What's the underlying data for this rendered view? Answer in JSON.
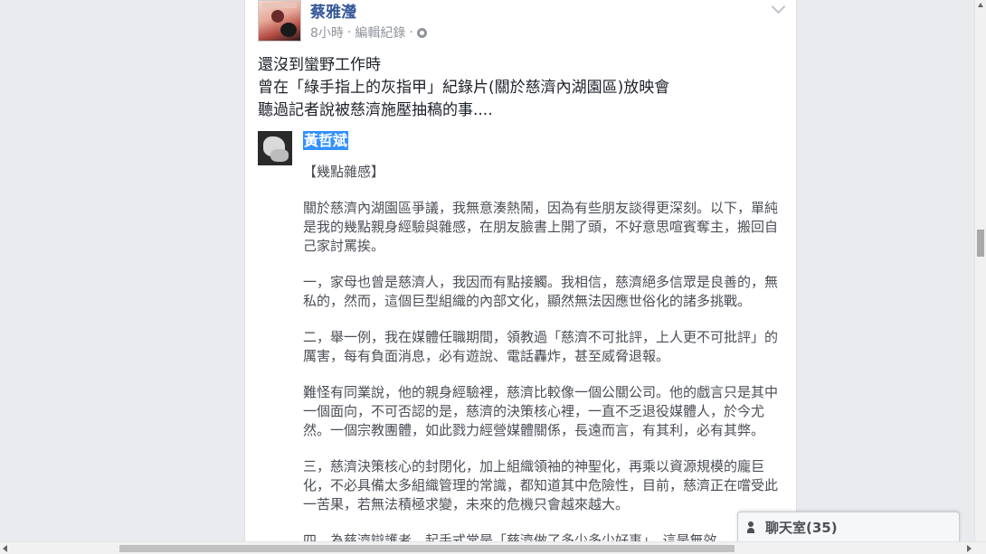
{
  "post": {
    "author_name": "蔡雅瀅",
    "time": "8小時",
    "separator": "·",
    "edit_history": "編輯紀錄",
    "separator2": "·",
    "text_lines": [
      "還沒到蠻野工作時",
      "曾在「綠手指上的灰指甲」紀錄片(關於慈濟內湖園區)放映會",
      "聽過記者說被慈濟施壓抽稿的事...."
    ]
  },
  "quote": {
    "name": "黃哲斌",
    "title": "【幾點雜感】",
    "paragraphs": [
      "關於慈濟內湖園區爭議，我無意湊熱鬧，因為有些朋友談得更深刻。以下，單純是我的幾點親身經驗與雜感，在朋友臉書上開了頭，不好意思喧賓奪主，搬回自己家討罵挨。",
      "一，家母也曾是慈濟人，我因而有點接觸。我相信，慈濟絕多信眾是良善的，無私的，然而，這個巨型組織的內部文化，顯然無法因應世俗化的諸多挑戰。",
      "二，舉一例，我在媒體任職期間，領教過「慈濟不可批評，上人更不可批評」的厲害，每有負面消息，必有遊說、電話轟炸，甚至威脅退報。",
      "難怪有同業說，他的親身經驗裡，慈濟比較像一個公關公司。他的戲言只是其中一個面向，不可否認的是，慈濟的決策核心裡，一直不乏退役媒體人，於今尤然。一個宗教團體，如此戮力經營媒體關係，長遠而言，有其利，必有其弊。",
      "三，慈濟決策核心的封閉化，加上組織領袖的神聖化，再乘以資源規模的龐巨化，不必具備太多組織管理的常識，都知道其中危險性，目前，慈濟正在嚐受此一苦果，若無法積極求變，未來的危機只會越來越大。",
      "四，為慈濟辯護者，起手式常是「慈濟做了多少多少好事」，這是無效"
    ]
  },
  "chat": {
    "label": "聊天室(35)"
  },
  "colors": {
    "link_blue": "#365899",
    "highlight": "#3390ff",
    "page_bg": "#e9ebee",
    "online_green": "#42b72a"
  }
}
